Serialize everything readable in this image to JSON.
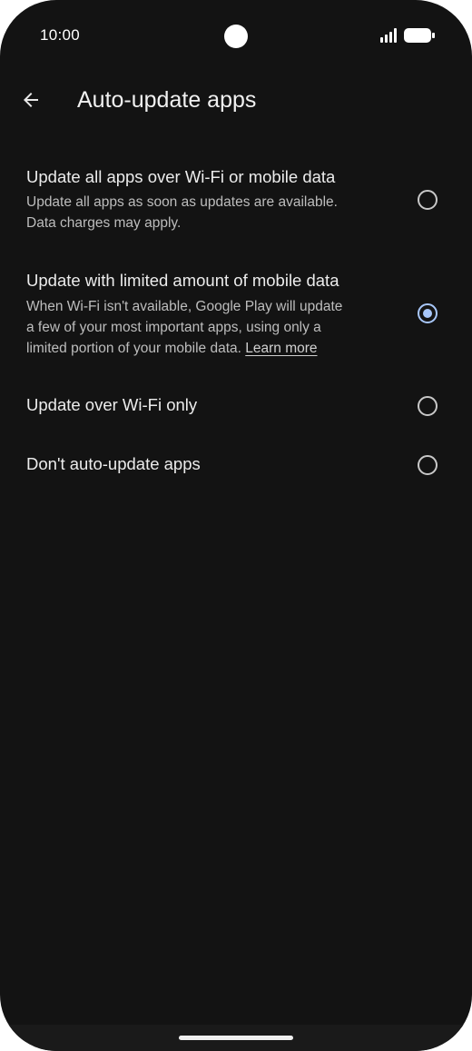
{
  "status_bar": {
    "time": "10:00"
  },
  "header": {
    "title": "Auto-update apps",
    "back_icon": "arrow-back-icon"
  },
  "options": [
    {
      "title": "Update all apps over Wi-Fi or mobile data",
      "description_lines": [
        "Update all apps as soon as updates are available.",
        "Data charges may apply."
      ],
      "selected": false
    },
    {
      "title": "Update with limited amount of mobile data",
      "description_lines": [
        "When Wi-Fi isn't available, Google Play will update",
        "a few of your most important apps, using only a",
        "limited portion of your mobile data."
      ],
      "link": "Learn more",
      "selected": true
    },
    {
      "title": "Update over Wi-Fi only",
      "selected": false
    },
    {
      "title": "Don't auto-update apps",
      "selected": false
    }
  ],
  "colors": {
    "background": "#131313",
    "accent": "#a8c7fa",
    "primary_text": "#ececec",
    "secondary_text": "#bdbdbd"
  }
}
